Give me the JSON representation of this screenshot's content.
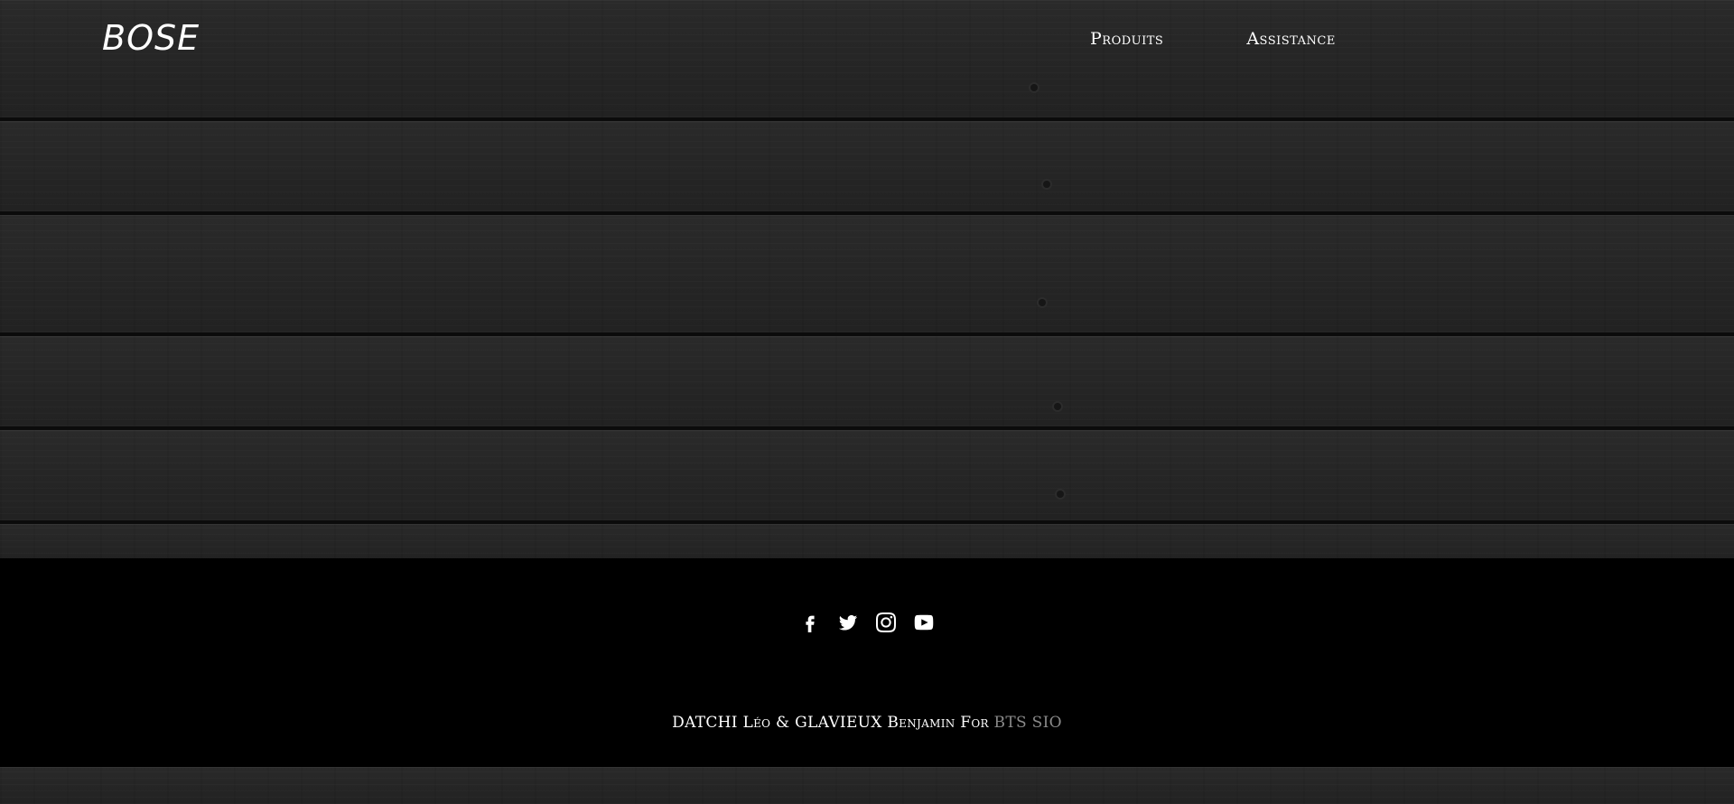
{
  "header": {
    "logo": "BOSE",
    "nav": {
      "products": "Produits",
      "support": "Assistance"
    }
  },
  "footer": {
    "social": [
      "facebook-icon",
      "twitter-icon",
      "instagram-icon",
      "youtube-icon"
    ],
    "credits": {
      "authors": "DATCHI Léo & GLAVIEUX Benjamin For",
      "program": "BTS SIO"
    }
  },
  "colors": {
    "background": "#242424",
    "footer": "#000000",
    "text": "#ffffff",
    "muted": "#8a8a8a"
  }
}
